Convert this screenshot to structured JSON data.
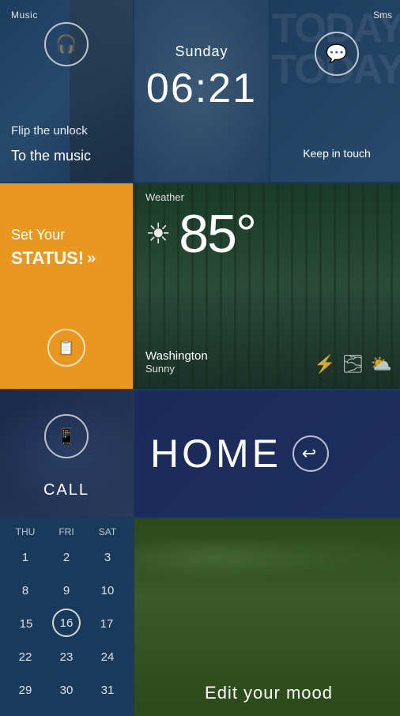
{
  "tiles": {
    "music": {
      "label": "Music",
      "flip": "Flip the unlock",
      "to_music": "To the music",
      "icon": "🎧"
    },
    "clock": {
      "day": "Sunday",
      "time": "06:21"
    },
    "sms": {
      "label": "Sms",
      "today_bg": "TODAY",
      "keep": "Keep in touch",
      "icon": "💬"
    },
    "status": {
      "set": "Set Your",
      "status": "STATUS!",
      "arrows": "»",
      "icon": "📋"
    },
    "weather": {
      "label": "Weather",
      "temp": "85°",
      "location": "Washington",
      "condition": "Sunny",
      "sun_icon": "☀",
      "icons": [
        "⚡",
        "🌫",
        "⛅"
      ]
    },
    "call": {
      "label": "CALL",
      "icon": "📱"
    },
    "home": {
      "label": "HOME",
      "icon": "↩"
    },
    "calendar": {
      "headers": [
        "THU",
        "FRI",
        "SAT"
      ],
      "rows": [
        [
          "1",
          "2",
          "3"
        ],
        [
          "8",
          "9",
          "10"
        ],
        [
          "15",
          "16",
          "17"
        ],
        [
          "22",
          "23",
          "24"
        ],
        [
          "29",
          "30",
          "31"
        ]
      ],
      "today": "16"
    },
    "mood": {
      "label": "Edit your mood"
    }
  }
}
